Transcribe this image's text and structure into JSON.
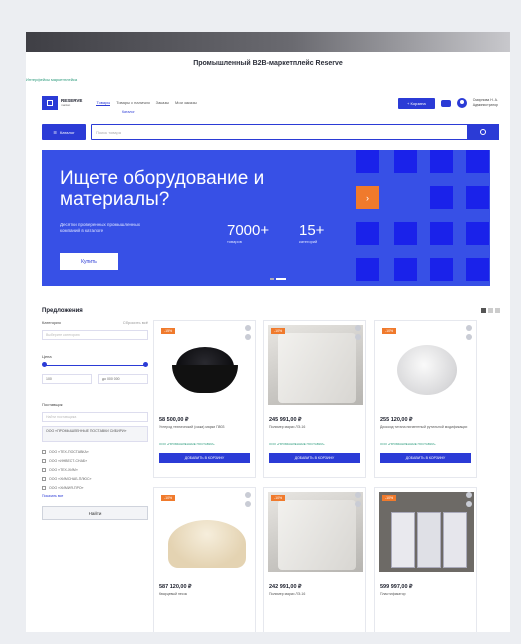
{
  "site_title": "Промышленный B2B-маркетплейс Reserve",
  "crumb_link": "Интерфейсы маркетплейса",
  "logo": {
    "line1": "RESERVE",
    "line2": "market"
  },
  "nav": {
    "items": [
      "Товары",
      "Товары с наличия",
      "Заказы",
      "Мои заказы"
    ],
    "sub": "Каталог"
  },
  "header": {
    "cart_label": "+ Корзина",
    "user_name": "Смирнова Н. А.",
    "user_role": "Администратор"
  },
  "search": {
    "catalog_label": "Каталог",
    "placeholder": "Поиск товара"
  },
  "hero": {
    "title": "Ищете оборудование и материалы?",
    "subtitle": "Десятки проверенных промышленных компаний в каталоге",
    "button": "Купить",
    "stat1_num": "7000+",
    "stat1_label": "товаров",
    "stat2_num": "15+",
    "stat2_label": "категорий",
    "arrow": "›",
    "accent": "#3750e6"
  },
  "section_title": "Предложения",
  "filters": {
    "category_label": "Категория",
    "reset_label": "Сбросить всё",
    "category_placeholder": "Выберите категорию",
    "price_label": "Цена",
    "price_from": "100",
    "price_to": "до 000 000",
    "supplier_label": "Поставщик",
    "supplier_placeholder": "Найти поставщика",
    "selected_supplier": "ООО «ПРОМЫШЛЕННЫЕ ПОСТАВКИ СИБИРИ»",
    "suppliers": [
      "ООО «ТЕХ-ПОСТАВКА»",
      "ООО «ИНВЕСТ-СНАБ»",
      "ООО «ТЕХ-ХИМ»",
      "ООО «ХИМСНАБ-ПЛЮС»",
      "ООО «ХИМИЯ-ПРО»"
    ],
    "show_all": "Показать все",
    "find_button": "Найти"
  },
  "products": [
    {
      "badge": "-15%",
      "price": "58 500,00 ₽",
      "desc": "Углерод технический (сажа) марки П803",
      "supplier": "ООО «ПРОМЫШЛЕННЫЕ ПОСТАВКИ»",
      "button": "ДОБАВИТЬ В КОРЗИНУ"
    },
    {
      "badge": "-10%",
      "price": "245 991,00 ₽",
      "desc": "Полимер марки ЛЭ-16",
      "supplier": "ООО «ПРОМЫШЛЕННЫЕ ПОСТАВКИ»",
      "button": "ДОБАВИТЬ В КОРЗИНУ"
    },
    {
      "badge": "-10%",
      "price": "255 120,00 ₽",
      "desc": "Диоксид титана пигментный рутильной модификации",
      "supplier": "ООО «ПРОМЫШЛЕННЫЕ ПОСТАВКИ»",
      "button": "ДОБАВИТЬ В КОРЗИНУ"
    },
    {
      "badge": "-10%",
      "price": "587 120,00 ₽",
      "desc": "Кварцевый песок",
      "supplier": "",
      "button": ""
    },
    {
      "badge": "-10%",
      "price": "242 991,00 ₽",
      "desc": "Полимер марки ЛЭ-16",
      "supplier": "",
      "button": ""
    },
    {
      "badge": "-10%",
      "price": "599 997,00 ₽",
      "desc": "Пластификатор",
      "supplier": "",
      "button": ""
    }
  ]
}
